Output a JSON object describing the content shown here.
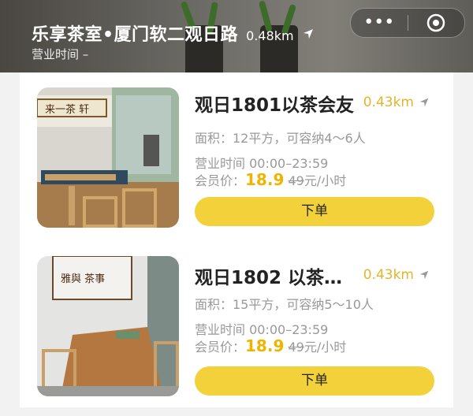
{
  "header": {
    "shop_name": "乐享茶室•厦门软二观日路",
    "distance": "0.48km",
    "hours_label": "营业时间 –",
    "more_icon": "more-icon",
    "close_icon": "target-icon"
  },
  "rooms": [
    {
      "title": "观日1801以茶会友",
      "distance": "0.43km",
      "area": "面积：12平方，可容纳4～6人",
      "hours": "营业时间 00:00–23:59",
      "price_label": "会员价：",
      "price_now": "18.9",
      "price_old": "49",
      "price_unit": "元/小时",
      "button": "下单",
      "calligraphy": "来一茶 轩"
    },
    {
      "title": "观日1802 以茶…",
      "distance": "0.43km",
      "area": "面积：15平方，可容纳5～10人",
      "hours": "营业时间 00:00–23:59",
      "price_label": "会员价：",
      "price_now": "18.9",
      "price_old": "49",
      "price_unit": "元/小时",
      "button": "下单",
      "calligraphy": "雅與 茶事"
    }
  ],
  "colors": {
    "accent": "#f2d13b",
    "price": "#f0b400",
    "distance": "#e2b52d"
  }
}
